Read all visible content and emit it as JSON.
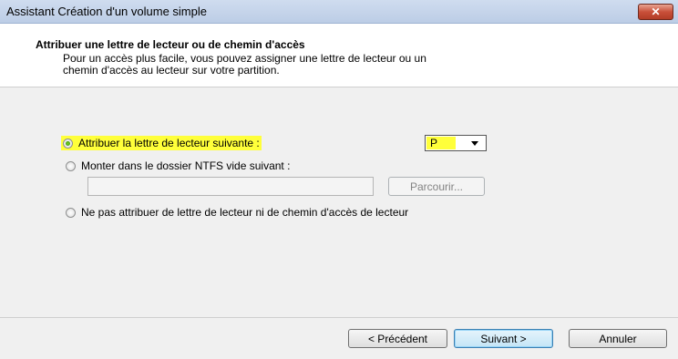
{
  "window": {
    "title": "Assistant Création d'un volume simple",
    "close_icon": "close-icon"
  },
  "header": {
    "title": "Attribuer une lettre de lecteur ou de chemin d'accès",
    "subtitle_line1": "Pour un accès plus facile, vous pouvez assigner une lettre de lecteur ou un",
    "subtitle_line2": "chemin d'accès au lecteur sur votre partition."
  },
  "options": {
    "assign_letter": {
      "label": "Attribuer la lettre de lecteur suivante :",
      "selected": true
    },
    "mount_folder": {
      "label": "Monter dans le dossier NTFS vide suivant :",
      "selected": false
    },
    "no_assign": {
      "label": "Ne pas attribuer de lettre de lecteur ni de chemin d'accès de lecteur",
      "selected": false
    }
  },
  "drive_letter": {
    "value": "P"
  },
  "path_field": {
    "value": ""
  },
  "browse_button": {
    "label": "Parcourir..."
  },
  "footer": {
    "back_label": "< Précédent",
    "next_label": "Suivant >",
    "cancel_label": "Annuler"
  },
  "colors": {
    "highlight": "#ffff3a",
    "title_bar": "#c6d6ec"
  }
}
